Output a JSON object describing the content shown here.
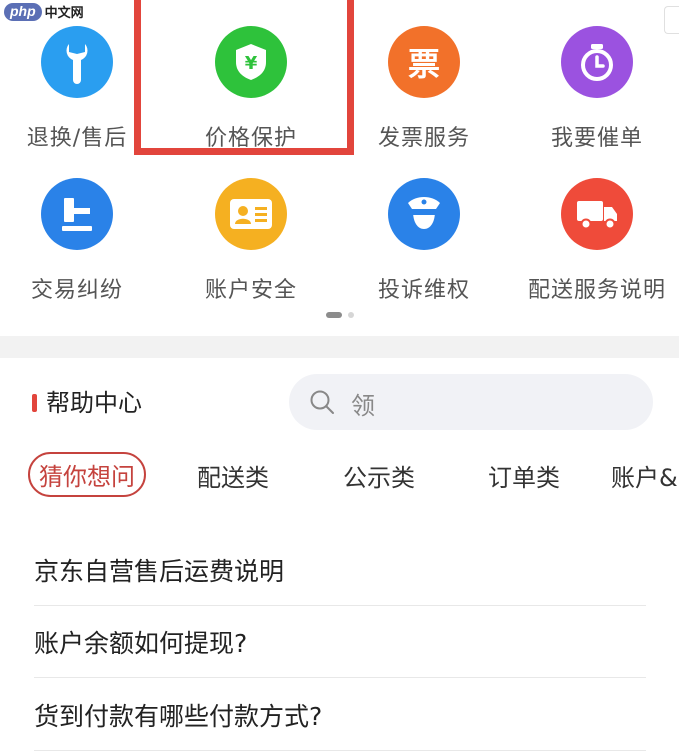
{
  "watermark": {
    "logo": "php",
    "text": "中文网"
  },
  "services": [
    {
      "label": "退换/售后",
      "icon": "wrench-icon",
      "color": "#2a9ef0"
    },
    {
      "label": "价格保护",
      "icon": "shield-yen-icon",
      "color": "#2ec23b"
    },
    {
      "label": "发票服务",
      "icon": "invoice-icon",
      "color": "#f2712a",
      "glyph": "票"
    },
    {
      "label": "我要催单",
      "icon": "timer-icon",
      "color": "#9b52e0"
    },
    {
      "label": "交易纠纷",
      "icon": "gavel-icon",
      "color": "#2a82e8"
    },
    {
      "label": "账户安全",
      "icon": "id-card-icon",
      "color": "#f5b021"
    },
    {
      "label": "投诉维权",
      "icon": "police-icon",
      "color": "#2a82e8"
    },
    {
      "label": "配送服务说明",
      "icon": "truck-icon",
      "color": "#ef4b3a"
    }
  ],
  "help": {
    "title": "帮助中心",
    "search_placeholder": "领"
  },
  "tabs": [
    {
      "label": "猜你想问",
      "active": true
    },
    {
      "label": "配送类"
    },
    {
      "label": "公示类"
    },
    {
      "label": "订单类"
    },
    {
      "label": "账户&"
    }
  ],
  "faq": [
    "京东自营售后运费说明",
    "账户余额如何提现?",
    "货到付款有哪些付款方式?"
  ],
  "highlight_color": "#e2453c"
}
